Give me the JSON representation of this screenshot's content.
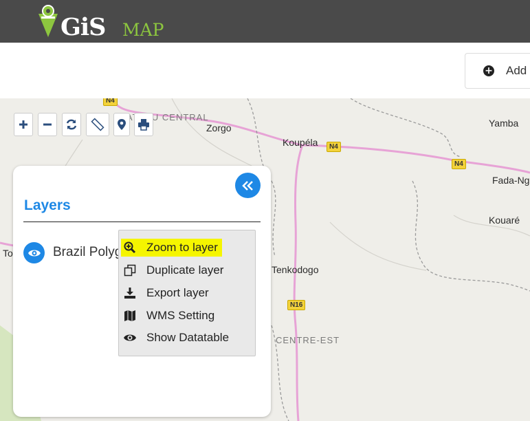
{
  "header": {
    "logo_main": "GiS",
    "logo_sub": "MAP"
  },
  "toolbar": {
    "add_label": "Add"
  },
  "map": {
    "places": [
      "Zorgo",
      "Koupéla",
      "Yamba",
      "Fada-Ng",
      "Kouaré",
      "To",
      "Tenkodogo"
    ],
    "regions": [
      "PLATEAU CENTRAL",
      "CENTRE-EST"
    ],
    "road_shields": [
      "N4",
      "N4",
      "N4",
      "N16"
    ],
    "controls": [
      "zoom-in",
      "zoom-out",
      "refresh",
      "measure",
      "location",
      "print"
    ]
  },
  "layers_panel": {
    "title": "Layers",
    "layers": [
      {
        "name": "Brazil Polygon"
      }
    ]
  },
  "context_menu": {
    "items": [
      {
        "label": "Zoom to layer",
        "icon": "zoom-in-icon",
        "highlighted": true
      },
      {
        "label": "Duplicate layer",
        "icon": "copy-icon"
      },
      {
        "label": "Export layer",
        "icon": "download-icon"
      },
      {
        "label": "WMS Setting",
        "icon": "map-icon"
      },
      {
        "label": "Show Datatable",
        "icon": "eye-icon"
      }
    ]
  },
  "colors": {
    "header_bg": "#4a4a4a",
    "accent": "#1e88e5",
    "logo_green": "#8dc63f",
    "highlight": "#f5f500",
    "road_pink": "#e7a3d6"
  }
}
